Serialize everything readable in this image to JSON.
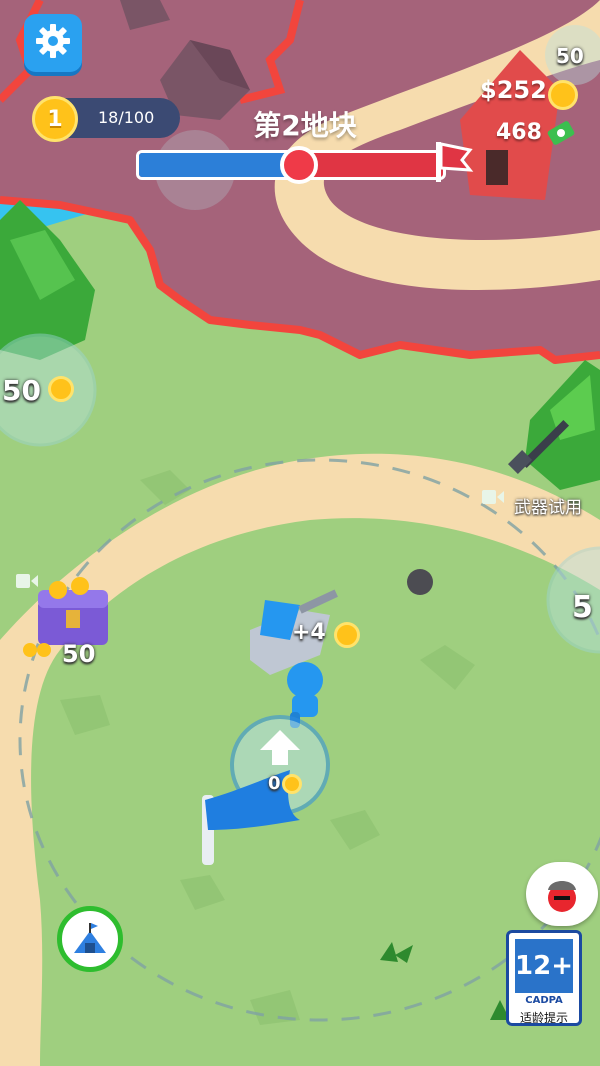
{
  "hud": {
    "settings_icon": "gear-icon",
    "level": "1",
    "xp_text": "18/100",
    "stage_title": "第2地块",
    "stage_progress": 0.5,
    "money": "$252",
    "cash": "468",
    "top_cost": "50"
  },
  "world": {
    "left_zone_cost": "50",
    "right_zone_cost": "5",
    "chest_cost": "50",
    "flag_cost": "0",
    "weapon_trial_label": "武器试用",
    "reward_popup": "+4"
  },
  "age_rating": {
    "rating": "12+",
    "org": "CADPA",
    "note": "适龄提示"
  },
  "colors": {
    "grass": "#9fcf7f",
    "locked_ground": "#a5637a",
    "border_red": "#f2453d",
    "path": "#f6dcae",
    "player_blue": "#2597f0",
    "water": "#36c3f0"
  }
}
